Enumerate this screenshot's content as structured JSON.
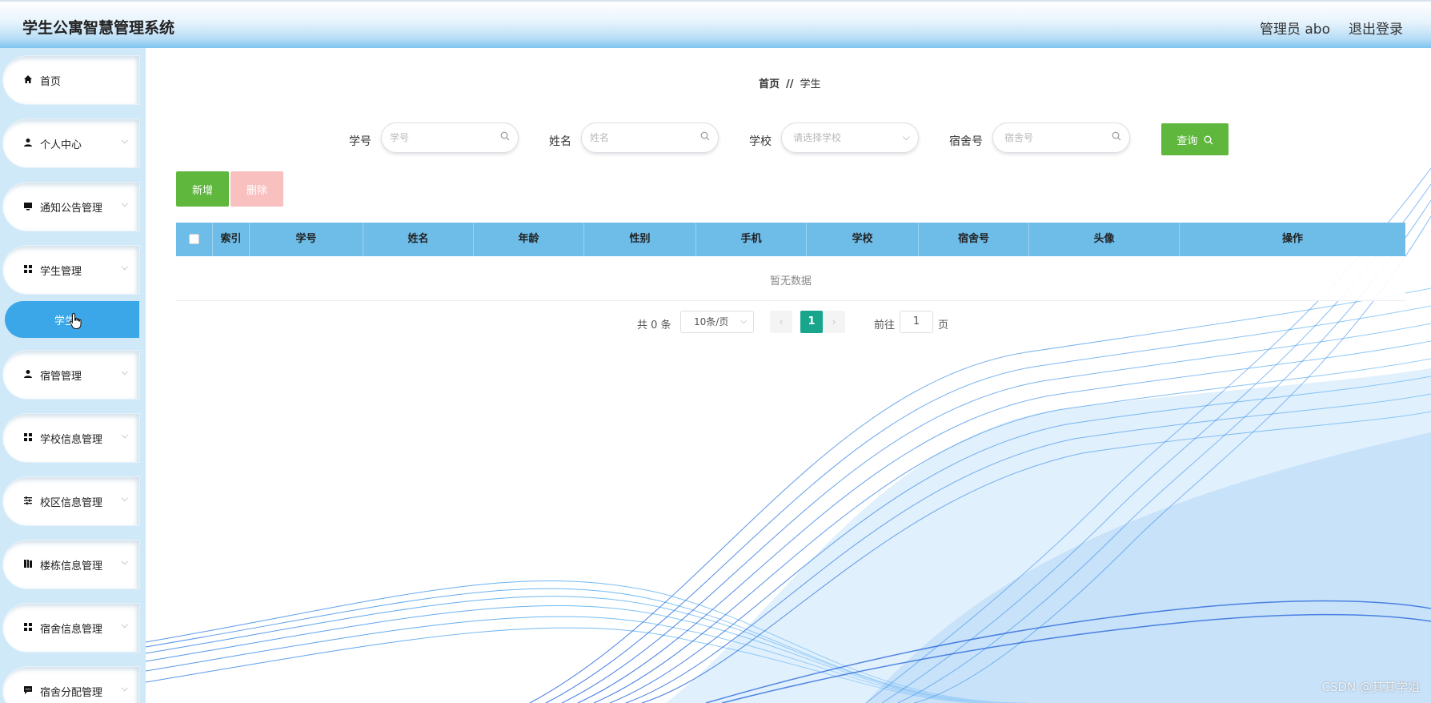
{
  "header": {
    "title": "学生公寓智慧管理系统",
    "user": "管理员 abo",
    "logout": "退出登录"
  },
  "sidebar": {
    "items": [
      {
        "label": "首页",
        "icon": "home-icon"
      },
      {
        "label": "个人中心",
        "icon": "person-icon"
      },
      {
        "label": "通知公告管理",
        "icon": "monitor-icon"
      },
      {
        "label": "学生管理",
        "icon": "grid-icon"
      },
      {
        "label": "宿管管理",
        "icon": "person-icon"
      },
      {
        "label": "学校信息管理",
        "icon": "grid-icon"
      },
      {
        "label": "校区信息管理",
        "icon": "sliders-icon"
      },
      {
        "label": "楼栋信息管理",
        "icon": "book-icon"
      },
      {
        "label": "宿舍信息管理",
        "icon": "grid-icon"
      },
      {
        "label": "宿舍分配管理",
        "icon": "chat-icon"
      }
    ],
    "active_sub": "学生"
  },
  "breadcrumb": {
    "home": "首页",
    "separator": "//",
    "current": "学生"
  },
  "search": {
    "student_id_label": "学号",
    "student_id_placeholder": "学号",
    "name_label": "姓名",
    "name_placeholder": "姓名",
    "school_label": "学校",
    "school_placeholder": "请选择学校",
    "dorm_label": "宿舍号",
    "dorm_placeholder": "宿舍号",
    "query_button": "查询"
  },
  "actions": {
    "add": "新增",
    "delete": "删除"
  },
  "table": {
    "columns": [
      "索引",
      "学号",
      "姓名",
      "年龄",
      "性别",
      "手机",
      "学校",
      "宿舍号",
      "头像",
      "操作"
    ],
    "empty": "暂无数据"
  },
  "pagination": {
    "total": "共 0 条",
    "page_size": "10条/页",
    "current_page": "1",
    "goto_label": "前往",
    "goto_value": "1",
    "unit": "页"
  },
  "watermark": "CSDN @其其学姐",
  "colors": {
    "accent": "#3ba7e8",
    "table_header": "#6ebde9",
    "button_green": "#5fb73e",
    "delete_disabled": "#f9c0c0",
    "page_active": "#17a68c"
  }
}
